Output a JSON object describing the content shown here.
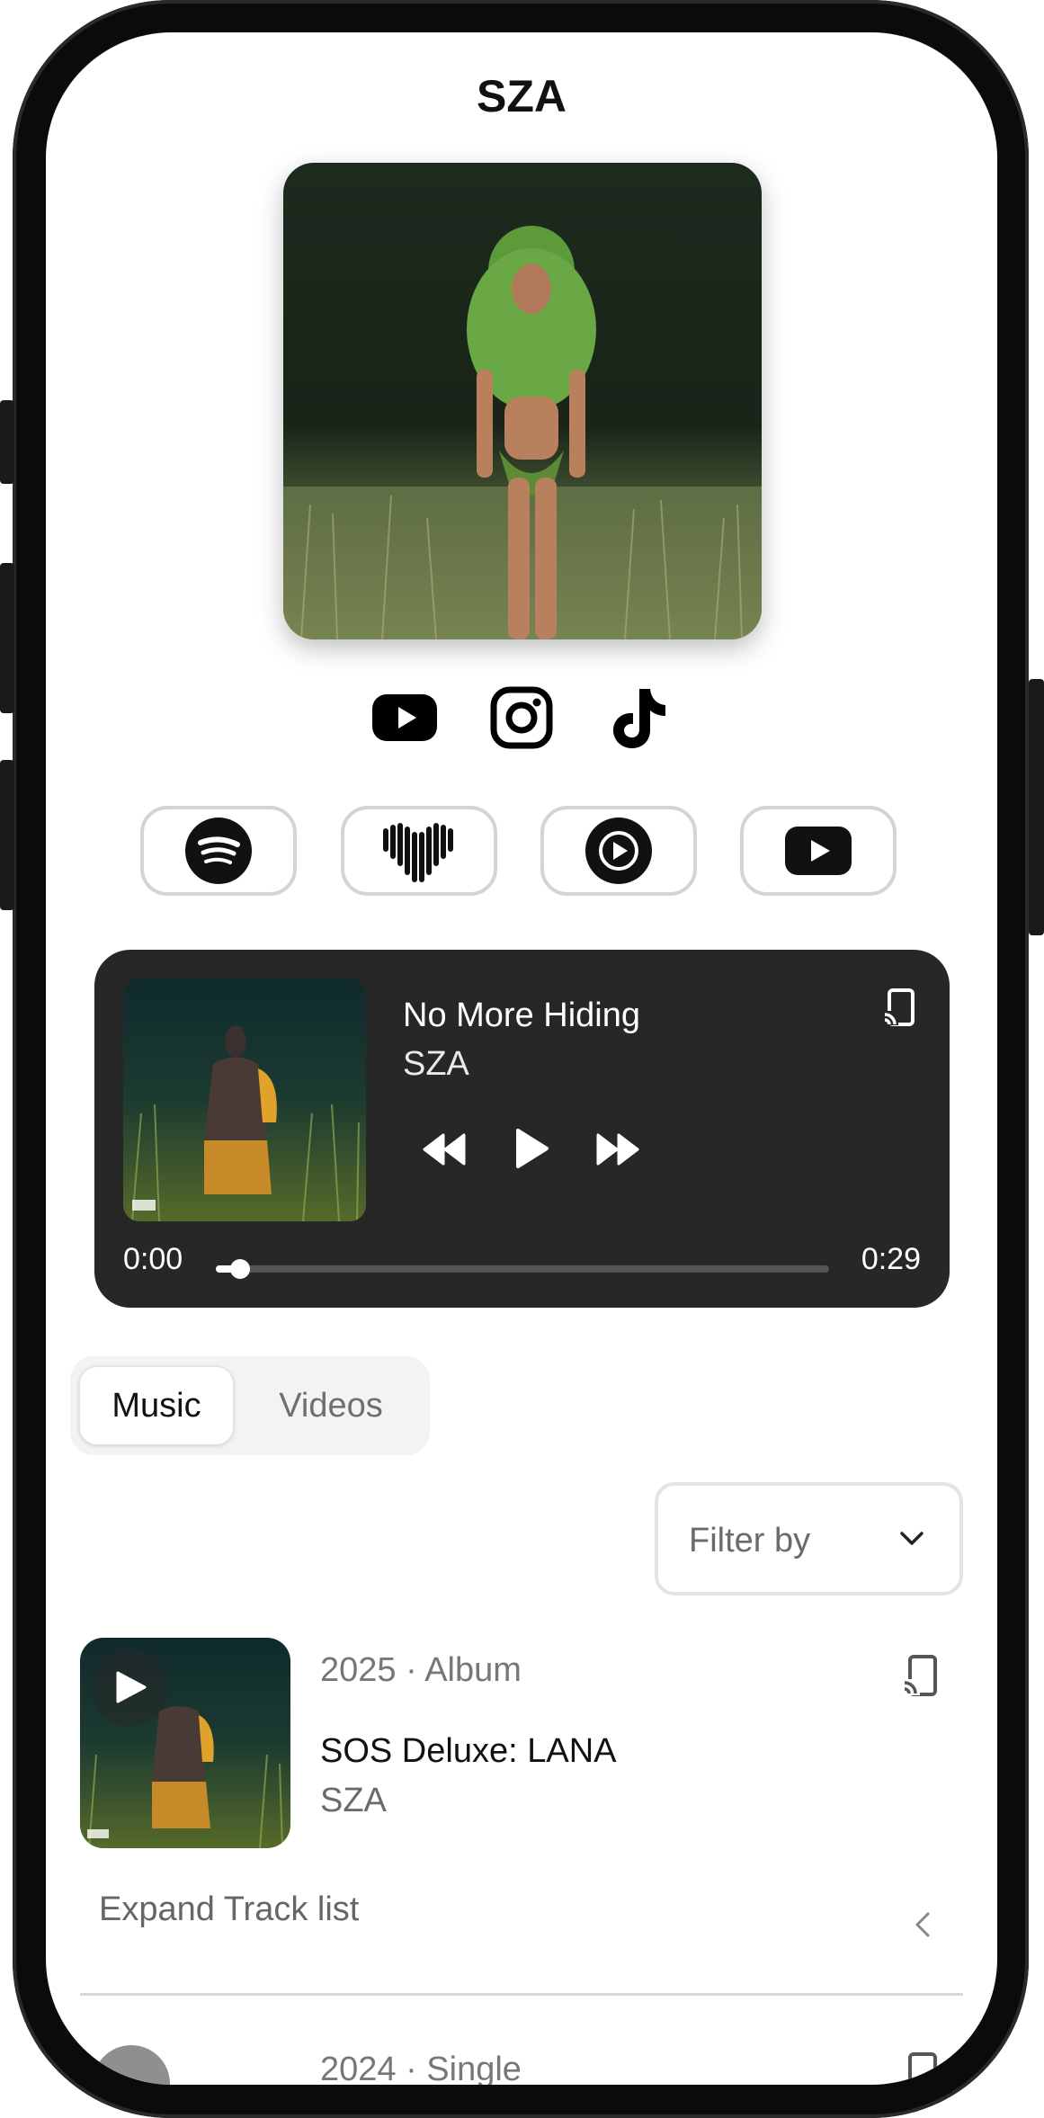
{
  "header": {
    "title": "SZA"
  },
  "hero": {
    "alt": "Artist photo"
  },
  "social_links": [
    {
      "name": "YouTube",
      "icon": "youtube-icon"
    },
    {
      "name": "Instagram",
      "icon": "instagram-icon"
    },
    {
      "name": "TikTok",
      "icon": "tiktok-icon"
    }
  ],
  "platforms": [
    {
      "name": "Spotify",
      "icon": "spotify-icon"
    },
    {
      "name": "Deezer",
      "icon": "deezer-icon"
    },
    {
      "name": "YouTube Music",
      "icon": "youtube-music-icon"
    },
    {
      "name": "YouTube",
      "icon": "youtube-icon"
    }
  ],
  "player": {
    "title": "No More Hiding",
    "artist": "SZA",
    "current_time": "0:00",
    "duration": "0:29",
    "progress_fraction": 0.03,
    "cast_icon": "cast-icon"
  },
  "tabs": {
    "music": "Music",
    "videos": "Videos",
    "active": "Music"
  },
  "filter": {
    "label": "Filter by"
  },
  "releases": [
    {
      "meta": "2025 · Album",
      "title": "SOS Deluxe: LANA",
      "artist": "SZA",
      "expand_label": "Expand Track list"
    },
    {
      "meta": "2024 · Single"
    }
  ],
  "colors": {
    "player_bg": "#272727",
    "accent_text": "#111111",
    "muted_text": "#777777"
  }
}
